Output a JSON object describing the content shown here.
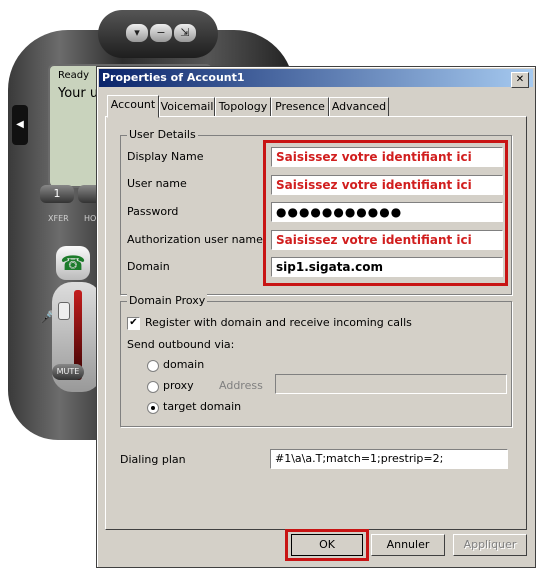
{
  "phone": {
    "screen_status": "Ready",
    "screen_line2": "Your us",
    "key1": "1",
    "xfer_label": "XFER",
    "hold_label": "HO",
    "mute_label": "MUTE",
    "icons": [
      "chevron-down-icon",
      "minus-icon",
      "arrow-down-icon",
      "handset-icon",
      "microphone-icon"
    ]
  },
  "dialog": {
    "title": "Properties of Account1",
    "close_label": "✕",
    "tabs": [
      "Account",
      "Voicemail",
      "Topology",
      "Presence",
      "Advanced"
    ],
    "active_tab": "Account",
    "user_details": {
      "title": "User Details",
      "display_name_label": "Display Name",
      "display_name_value": "Saisissez votre identifiant ici",
      "user_name_label": "User name",
      "user_name_value": "Saisissez votre identifiant ici",
      "password_label": "Password",
      "password_value": "●●●●●●●●●●●",
      "auth_user_label": "Authorization user name",
      "auth_user_value": "Saisissez votre identifiant ici",
      "domain_label": "Domain",
      "domain_value": "sip1.sigata.com"
    },
    "domain_proxy": {
      "title": "Domain Proxy",
      "register_label": "Register with domain and receive incoming calls",
      "register_checked": "✔",
      "send_outbound_label": "Send outbound via:",
      "opt_domain": "domain",
      "opt_proxy": "proxy",
      "address_label": "Address",
      "address_value": "",
      "opt_target": "target domain",
      "selected": "target domain"
    },
    "dialing_plan_label": "Dialing plan",
    "dialing_plan_value": "#1\\a\\a.T;match=1;prestrip=2;",
    "buttons": {
      "ok": "OK",
      "cancel": "Annuler",
      "apply": "Appliquer"
    },
    "colors": {
      "highlight": "#c81414",
      "red_text": "#d11e1e",
      "titlebar": "#0a246a"
    }
  }
}
